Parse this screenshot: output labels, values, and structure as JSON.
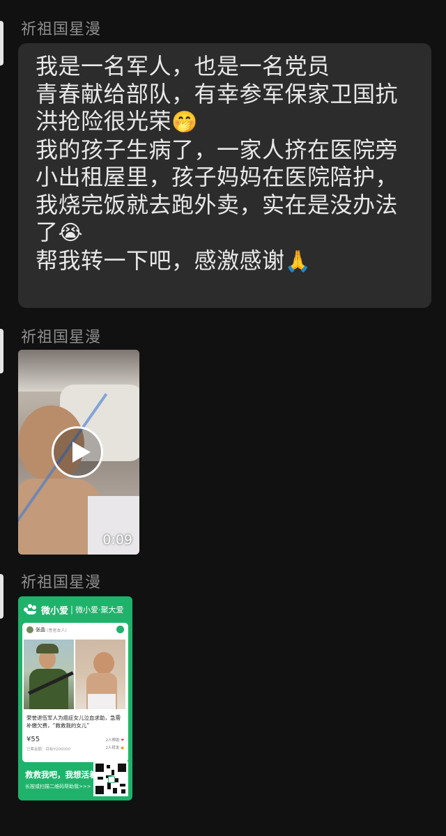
{
  "chat": {
    "messages": [
      {
        "sender": "祈祖国星漫",
        "lines": [
          "我是一名军人，也是一名党员",
          "青春献给部队，有幸参军保家卫国抗",
          "洪抢险很光荣",
          "我的孩子生病了，一家人挤在医院旁",
          "小出租屋里，孩子妈妈在医院陪护，",
          "我烧完饭就去跑外卖，实在是没办法",
          "了",
          "帮我转一下吧，感激感谢"
        ],
        "emojis": [
          "face-with-hand-over-mouth-emoji",
          "loudly-crying-emoji",
          "folded-hands-emoji"
        ]
      },
      {
        "sender": "祈祖国星漫",
        "video": {
          "duration": "0:09",
          "icon": "play-icon"
        }
      },
      {
        "sender": "祈祖国星漫",
        "card": {
          "brand": "微小爱",
          "slogan": "微小爱·聚大爱",
          "poster_name": "张晶",
          "poster_tag": "(患者本人)",
          "description": "荣誉退伍军人为癌症女儿泣血求助，急需补缴欠费，“救救我的女儿”",
          "amount": "¥55",
          "raised_note": "已筹金额：目标¥200000",
          "helpers": "2人帮助",
          "shares": "2人转发",
          "cta": "救救我吧，我想活着",
          "sub": "长按或扫描二维码帮助我>>>",
          "brand_color": "#1fb26b"
        }
      }
    ]
  }
}
